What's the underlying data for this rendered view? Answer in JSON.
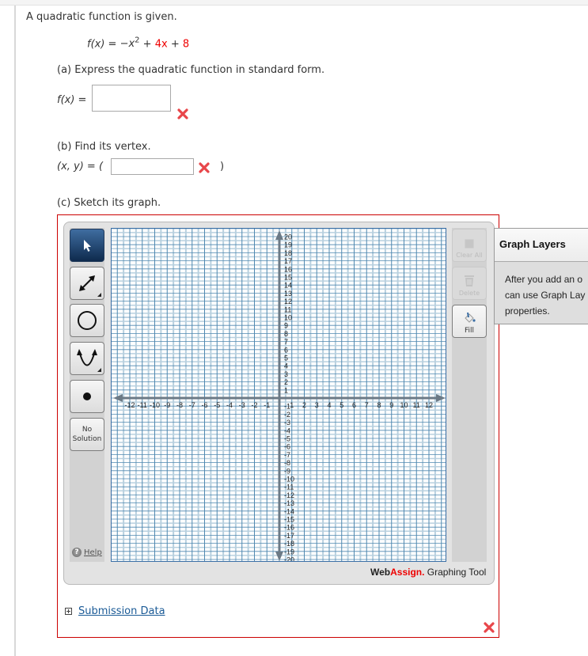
{
  "question": {
    "prompt": "A quadratic function is given.",
    "function": {
      "lhs": "f(x) = ",
      "term1": "−x",
      "term1_exponent": "2",
      "plus1": " + ",
      "coef": "4x",
      "plus2": " + ",
      "const": "8"
    },
    "part_a": {
      "label": "(a) Express the quadratic function in standard form.",
      "field_label": "f(x) =",
      "value": "",
      "status": "incorrect"
    },
    "part_b": {
      "label": "(b) Find its vertex.",
      "field_label": "(x, y) = (",
      "close_paren": ")",
      "value": "",
      "status": "incorrect"
    },
    "part_c": {
      "label": "(c) Sketch its graph.",
      "status": "incorrect"
    }
  },
  "graph_tool": {
    "left_tools": [
      {
        "name": "select",
        "icon": "pointer-icon",
        "active": true
      },
      {
        "name": "line",
        "icon": "line-arrows-icon",
        "active": false,
        "has_submenu": true
      },
      {
        "name": "circle",
        "icon": "circle-icon",
        "active": false
      },
      {
        "name": "parabola",
        "icon": "parabola-icon",
        "active": false,
        "has_submenu": true
      },
      {
        "name": "point",
        "icon": "point-icon",
        "active": false
      },
      {
        "name": "no-solution",
        "label_line1": "No",
        "label_line2": "Solution",
        "active": false
      }
    ],
    "help_label": "Help",
    "right_tools": [
      {
        "name": "clear-all",
        "label": "Clear All",
        "enabled": false
      },
      {
        "name": "delete",
        "label": "Delete",
        "enabled": false
      },
      {
        "name": "fill",
        "label": "Fill",
        "enabled": true
      }
    ],
    "brand": {
      "web": "Web",
      "assign": "Assign.",
      "suffix": " Graphing Tool"
    },
    "axes": {
      "x_min": -13,
      "x_max": 13,
      "y_min": -21,
      "y_max": 21,
      "x_ticks": [
        -12,
        -11,
        -10,
        -9,
        -8,
        -7,
        -6,
        -5,
        -4,
        -3,
        -2,
        -1,
        1,
        2,
        3,
        4,
        5,
        6,
        7,
        8,
        9,
        10,
        11,
        12
      ],
      "y_ticks": [
        20,
        19,
        18,
        17,
        16,
        15,
        14,
        13,
        12,
        11,
        10,
        9,
        8,
        7,
        6,
        5,
        4,
        3,
        2,
        1,
        -1,
        -2,
        -3,
        -4,
        -5,
        -6,
        -7,
        -8,
        -9,
        -10,
        -11,
        -12,
        -13,
        -14,
        -15,
        -16,
        -17,
        -18,
        -19,
        -20
      ]
    }
  },
  "graph_layers": {
    "title": "Graph Layers",
    "line1": "After you add an o",
    "line2": "can use Graph Lay",
    "line3": "properties."
  },
  "submission_data": {
    "label": "Submission Data"
  },
  "colors": {
    "accent_red": "#ee0000",
    "box_border": "#cc0000",
    "grid_major": "#4f88b0",
    "grid_minor": "#b8d0df",
    "axis": "#6c7a86"
  }
}
